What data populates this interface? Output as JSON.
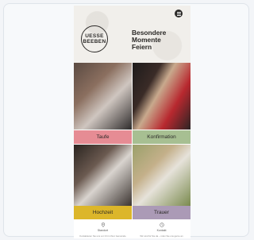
{
  "header": {
    "logo_line1": "UESSE",
    "logo_line2": "BEEBEN",
    "headline_line1": "Besondere",
    "headline_line2": "Momente",
    "headline_line3": "Feiern"
  },
  "tiles": [
    {
      "label": "Taufe",
      "color": "#e68c94"
    },
    {
      "label": "Konfirmation",
      "color": "#a7bf92"
    },
    {
      "label": "Hochzeit",
      "color": "#dcb62a"
    },
    {
      "label": "Trauer",
      "color": "#ab9ab6"
    }
  ],
  "footer": {
    "left_title": "Standort",
    "left_text": "Kontaktieren Sie uns vor Ort in Ihrer Gemeinde",
    "right_title": "Kontakt",
    "right_text": "Wir sind für Sie da – rufen Sie uns gerne an"
  }
}
